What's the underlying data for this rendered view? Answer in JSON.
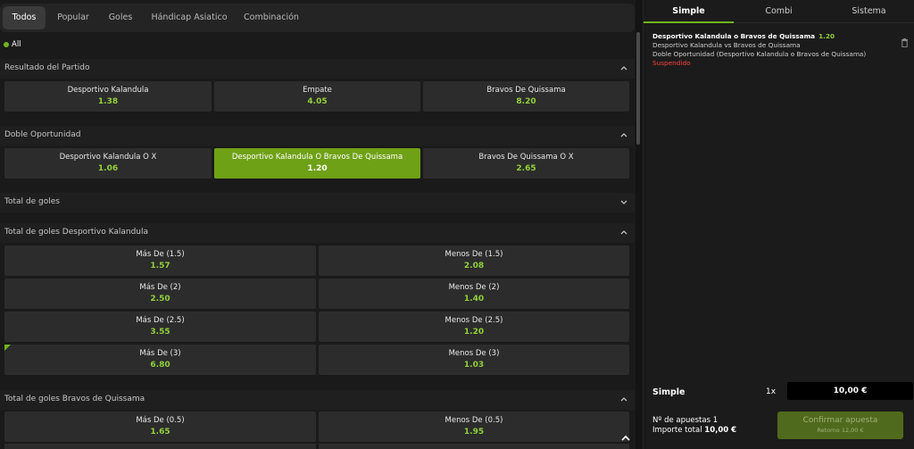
{
  "tabs": [
    "Todos",
    "Popular",
    "Goles",
    "Hándicap Asiatico",
    "Combinación"
  ],
  "filter_label": "All",
  "sections": {
    "resultado": {
      "title": "Resultado del Partido",
      "cells": [
        {
          "label": "Desportivo Kalandula",
          "odd": "1.38"
        },
        {
          "label": "Empate",
          "odd": "4.05"
        },
        {
          "label": "Bravos De Quissama",
          "odd": "8.20"
        }
      ]
    },
    "doble": {
      "title": "Doble Oportunidad",
      "cells": [
        {
          "label": "Desportivo Kalandula O X",
          "odd": "1.06"
        },
        {
          "label": "Desportivo Kalandula O Bravos De Quissama",
          "odd": "1.20"
        },
        {
          "label": "Bravos De Quissama O X",
          "odd": "2.65"
        }
      ]
    },
    "total": {
      "title": "Total de goles"
    },
    "total_kalandula": {
      "title": "Total de goles Desportivo Kalandula",
      "rows": [
        [
          {
            "label": "Más De (1.5)",
            "odd": "1.57"
          },
          {
            "label": "Menos De (1.5)",
            "odd": "2.08"
          }
        ],
        [
          {
            "label": "Más De (2)",
            "odd": "2.50"
          },
          {
            "label": "Menos De (2)",
            "odd": "1.40"
          }
        ],
        [
          {
            "label": "Más De (2.5)",
            "odd": "3.55"
          },
          {
            "label": "Menos De (2.5)",
            "odd": "1.20"
          }
        ],
        [
          {
            "label": "Más De (3)",
            "odd": "6.80"
          },
          {
            "label": "Menos De (3)",
            "odd": "1.03"
          }
        ]
      ]
    },
    "total_bravos": {
      "title": "Total de goles Bravos de Quissama",
      "rows": [
        [
          {
            "label": "Más De (0.5)",
            "odd": "1.65"
          },
          {
            "label": "Menos De (0.5)",
            "odd": "1.95"
          }
        ]
      ]
    }
  },
  "betslip": {
    "tabs": [
      "Simple",
      "Combi",
      "Sistema"
    ],
    "item": {
      "title": "Desportivo Kalandula o Bravos de Quissama",
      "odd": "1.20",
      "match": "Desportivo Kalandula vs Bravos de Quissama",
      "market": "Doble Oportunidad (Desportivo Kalandula o Bravos de Quissama)",
      "status": "Suspendido"
    },
    "summary_label": "Simple",
    "multiplier": "1x",
    "stake": "10,00 €",
    "bets_count": "Nº de apuestas 1",
    "total_label": "Importe total",
    "total_value": "10,00 €",
    "confirm_label": "Confirmar apuesta",
    "return_label": "Retorno 12,00 €"
  },
  "colors": {
    "accent": "#6fb51d",
    "odd": "#92d13a",
    "selected": "#6fa116",
    "error": "#ff4040"
  }
}
